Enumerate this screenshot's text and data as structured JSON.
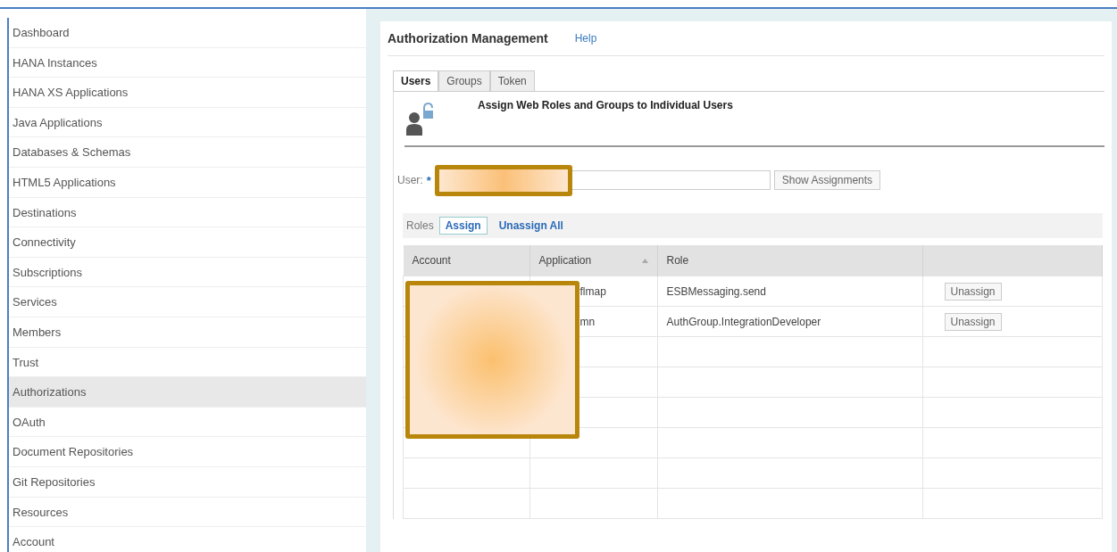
{
  "sidebar": {
    "items": [
      {
        "label": "Dashboard",
        "selected": false
      },
      {
        "label": "HANA Instances",
        "selected": false
      },
      {
        "label": "HANA XS Applications",
        "selected": false
      },
      {
        "label": "Java Applications",
        "selected": false
      },
      {
        "label": "Databases & Schemas",
        "selected": false
      },
      {
        "label": "HTML5 Applications",
        "selected": false
      },
      {
        "label": "Destinations",
        "selected": false
      },
      {
        "label": "Connectivity",
        "selected": false
      },
      {
        "label": "Subscriptions",
        "selected": false
      },
      {
        "label": "Services",
        "selected": false
      },
      {
        "label": "Members",
        "selected": false
      },
      {
        "label": "Trust",
        "selected": false
      },
      {
        "label": "Authorizations",
        "selected": true
      },
      {
        "label": "OAuth",
        "selected": false
      },
      {
        "label": "Document Repositories",
        "selected": false
      },
      {
        "label": "Git Repositories",
        "selected": false
      },
      {
        "label": "Resources",
        "selected": false
      },
      {
        "label": "Account",
        "selected": false
      }
    ]
  },
  "header": {
    "title": "Authorization Management",
    "help": "Help"
  },
  "tabs": [
    {
      "label": "Users",
      "selected": true
    },
    {
      "label": "Groups",
      "selected": false
    },
    {
      "label": "Token",
      "selected": false
    }
  ],
  "section": {
    "title": "Assign Web Roles and Groups to Individual Users"
  },
  "user": {
    "label": "User:",
    "required": "*",
    "redacted": true,
    "button": "Show Assignments"
  },
  "roles": {
    "label": "Roles",
    "actions": [
      {
        "label": "Assign",
        "selected": true
      },
      {
        "label": "Unassign All",
        "selected": false
      }
    ]
  },
  "table": {
    "columns": [
      {
        "label": "Account",
        "sorted": false
      },
      {
        "label": "Application",
        "sorted": true
      },
      {
        "label": "Role",
        "sorted": false
      },
      {
        "sorted": false
      }
    ],
    "redacted": true,
    "rows": [
      {
        "application": "flmap",
        "role": "ESBMessaging.send",
        "action": "Unassign"
      },
      {
        "application": "mn",
        "role": "AuthGroup.IntegrationDeveloper",
        "action": "Unassign"
      }
    ]
  }
}
